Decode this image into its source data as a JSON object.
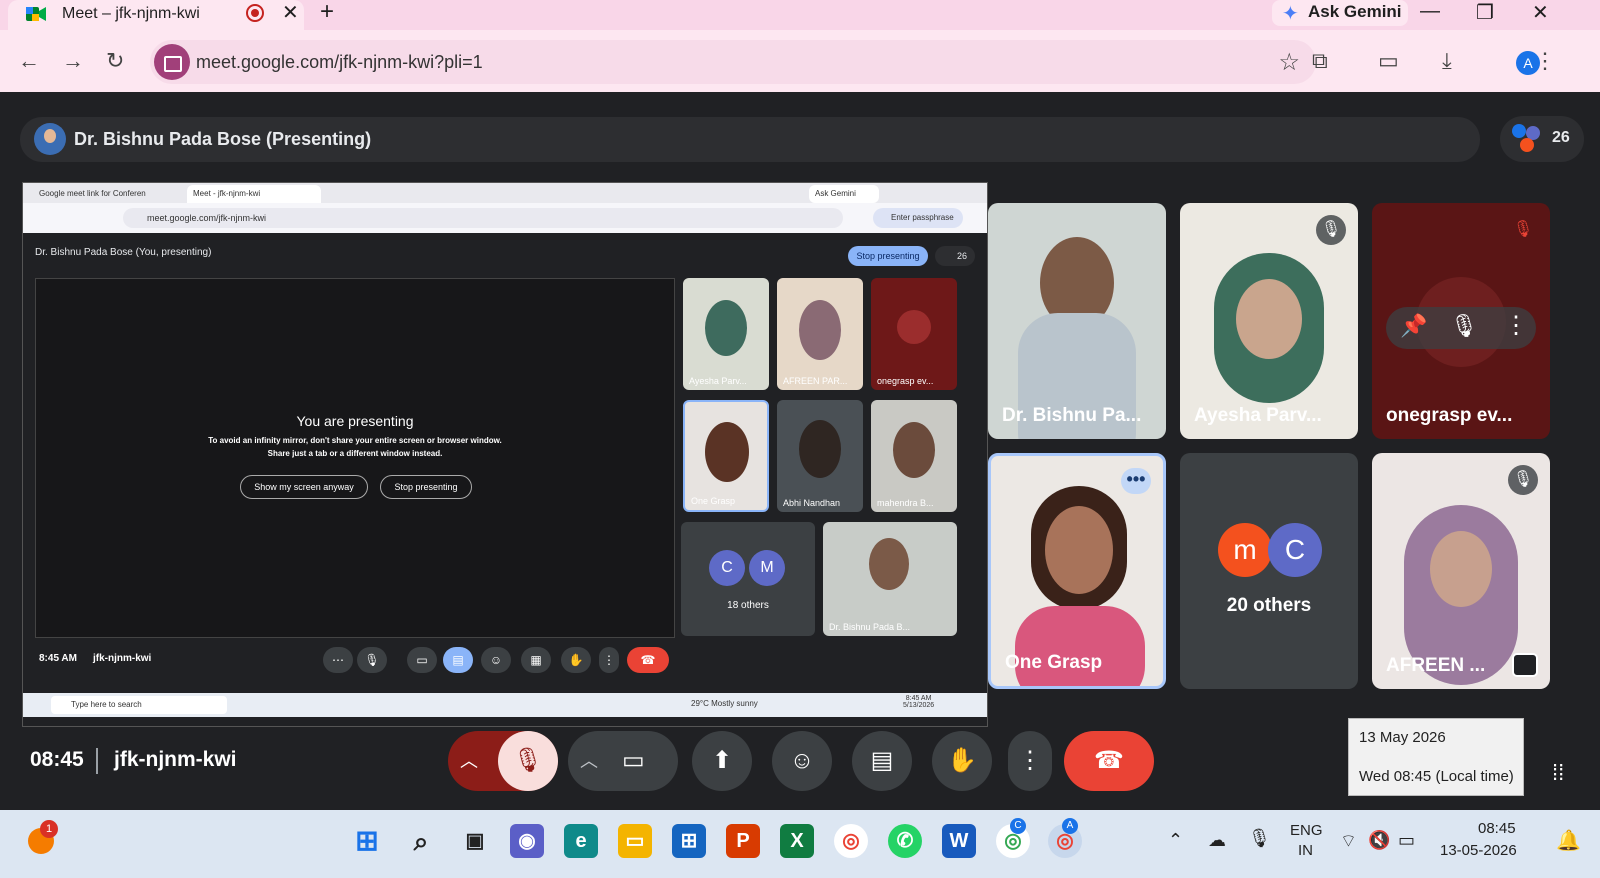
{
  "browser": {
    "tab_title": "Meet – jfk-njnm-kwi",
    "new_tab_symbol": "+",
    "gemini_label": "Ask Gemini",
    "url": "meet.google.com/jfk-njnm-kwi?pli=1",
    "profile_initial": "A"
  },
  "header": {
    "presenter_label": "Dr. Bishnu Pada Bose (Presenting)",
    "participant_count": "26"
  },
  "presentation": {
    "tabs": [
      "Google meet link for Conferen",
      "Meet - jfk-njnm-kwi"
    ],
    "gemini": "Ask Gemini",
    "url": "meet.google.com/jfk-njnm-kwi",
    "passphrase": "Enter passphrase",
    "head_label": "Dr. Bishnu Pada Bose (You, presenting)",
    "stop_presenting": "Stop presenting",
    "count": "26",
    "dialog_title": "You are presenting",
    "dialog_line1": "To avoid an infinity mirror, don't share your entire screen or browser window.",
    "dialog_line2": "Share just a tab or a different window instead.",
    "show_anyway": "Show my screen anyway",
    "stop_btn": "Stop presenting",
    "tiles": [
      "Ayesha Parv...",
      "AFREEN PAR...",
      "onegrasp ev...",
      "One Grasp",
      "Abhi Nandhan",
      "mahendra B...",
      "Dr. Bishnu Pada B..."
    ],
    "others_initials": [
      "C",
      "M"
    ],
    "others_label": "18 others",
    "time": "8:45 AM",
    "code": "jfk-njnm-kwi",
    "search_placeholder": "Type here to search",
    "weather": "29°C  Mostly sunny",
    "lang": "ENG\nIN",
    "clock_time": "8:45 AM",
    "clock_date": "5/13/2026"
  },
  "participants": [
    {
      "name": "Dr. Bishnu Pa...",
      "bg": "#cfd6d3"
    },
    {
      "name": "Ayesha Parv...",
      "bg": "#ece9e2"
    },
    {
      "name": "onegrasp ev...",
      "bg": "#5a1515"
    },
    {
      "name": "One Grasp",
      "bg": "#ece8e4"
    },
    {
      "name": "20 others",
      "bg": "#3c4043"
    },
    {
      "name": "AFREEN ...",
      "bg": "#ece6e4"
    }
  ],
  "others_initials": [
    "m",
    "C"
  ],
  "bottom": {
    "time": "08:45",
    "code": "jfk-njnm-kwi"
  },
  "tooltip": {
    "date": "13 May 2026",
    "time": "Wed 08:45 (Local time)"
  },
  "taskbar": {
    "notification_count": "1",
    "lang_line1": "ENG",
    "lang_line2": "IN",
    "clock_time": "08:45",
    "clock_date": "13-05-2026",
    "chrome_badge_1": "C",
    "chrome_badge_2": "A"
  },
  "colors": {
    "hangup": "#ea4335",
    "mic_off_bg": "#f9dedc",
    "accent_blue": "#8ab4f8"
  }
}
